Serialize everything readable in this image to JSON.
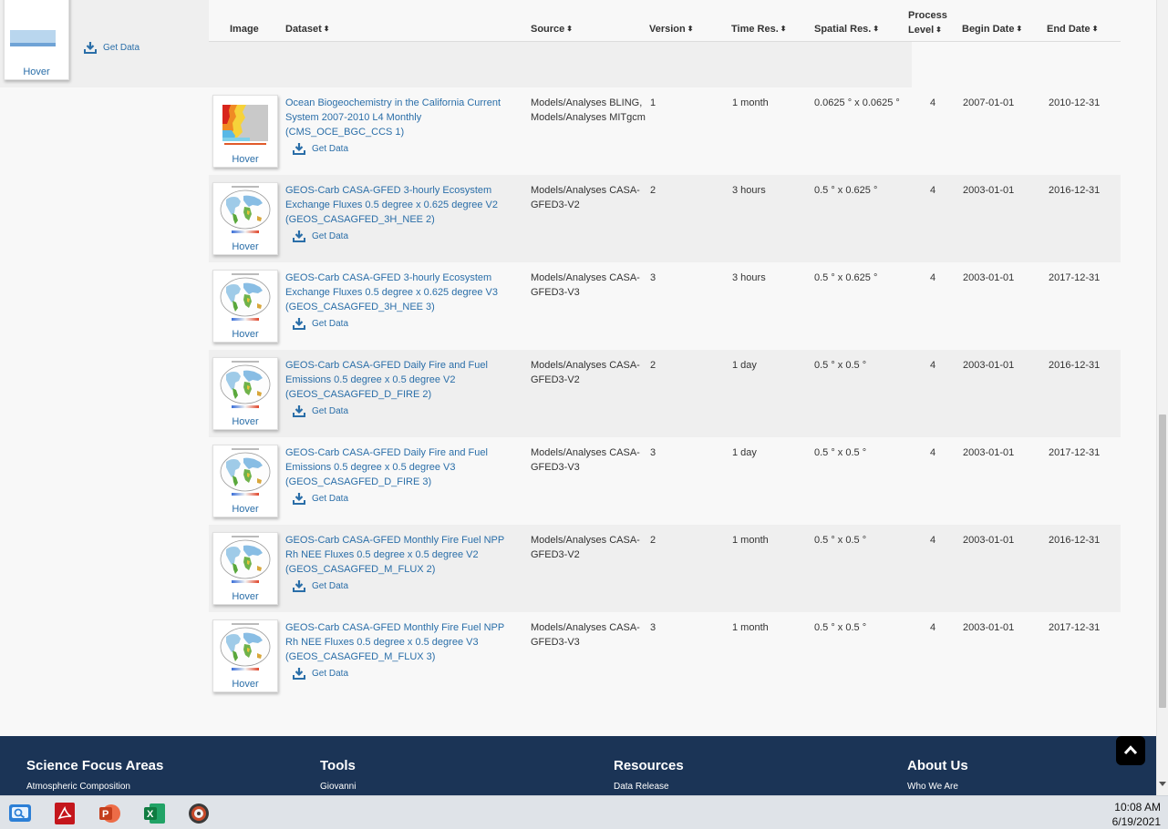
{
  "table": {
    "headers": {
      "image": "Image",
      "dataset": "Dataset",
      "source": "Source",
      "version": "Version",
      "time_res": "Time Res.",
      "spatial_res": "Spatial Res.",
      "process_level_1": "Process",
      "process_level_2": "Level",
      "begin_date": "Begin Date",
      "end_date": "End Date"
    },
    "sort_glyph": "⬍",
    "hover_label": "Hover",
    "get_data_label": "Get Data",
    "rows": [
      {
        "dataset": "Ocean Biogeochemistry in the California Current System 2007-2010 L4 Monthly (CMS_OCE_BGC_CCS 1)",
        "source": "Models/Analyses BLING, Models/Analyses MITgcm",
        "version": "1",
        "time_res": "1 month",
        "spatial_res": "0.0625 ° x 0.0625 °",
        "process_level": "4",
        "begin_date": "2007-01-01",
        "end_date": "2010-12-31",
        "thumb_type": "ocean-heatmap"
      },
      {
        "dataset": "GEOS-Carb CASA-GFED 3-hourly Ecosystem Exchange Fluxes 0.5 degree x 0.625 degree V2 (GEOS_CASAGFED_3H_NEE 2)",
        "source": "Models/Analyses CASA-GFED3-V2",
        "version": "2",
        "time_res": "3 hours",
        "spatial_res": "0.5 ° x 0.625 °",
        "process_level": "4",
        "begin_date": "2003-01-01",
        "end_date": "2016-12-31",
        "thumb_type": "globe-map"
      },
      {
        "dataset": "GEOS-Carb CASA-GFED 3-hourly Ecosystem Exchange Fluxes 0.5 degree x 0.625 degree V3 (GEOS_CASAGFED_3H_NEE 3)",
        "source": "Models/Analyses CASA-GFED3-V3",
        "version": "3",
        "time_res": "3 hours",
        "spatial_res": "0.5 ° x 0.625 °",
        "process_level": "4",
        "begin_date": "2003-01-01",
        "end_date": "2017-12-31",
        "thumb_type": "globe-map"
      },
      {
        "dataset": "GEOS-Carb CASA-GFED Daily Fire and Fuel Emissions 0.5 degree x 0.5 degree V2 (GEOS_CASAGFED_D_FIRE 2)",
        "source": "Models/Analyses CASA-GFED3-V2",
        "version": "2",
        "time_res": "1 day",
        "spatial_res": "0.5 ° x 0.5 °",
        "process_level": "4",
        "begin_date": "2003-01-01",
        "end_date": "2016-12-31",
        "thumb_type": "globe-map"
      },
      {
        "dataset": "GEOS-Carb CASA-GFED Daily Fire and Fuel Emissions 0.5 degree x 0.5 degree V3 (GEOS_CASAGFED_D_FIRE 3)",
        "source": "Models/Analyses CASA-GFED3-V3",
        "version": "3",
        "time_res": "1 day",
        "spatial_res": "0.5 ° x 0.5 °",
        "process_level": "4",
        "begin_date": "2003-01-01",
        "end_date": "2017-12-31",
        "thumb_type": "globe-map"
      },
      {
        "dataset": "GEOS-Carb CASA-GFED Monthly Fire Fuel NPP Rh NEE Fluxes 0.5 degree x 0.5 degree V2 (GEOS_CASAGFED_M_FLUX 2)",
        "source": "Models/Analyses CASA-GFED3-V2",
        "version": "2",
        "time_res": "1 month",
        "spatial_res": "0.5 ° x 0.5 °",
        "process_level": "4",
        "begin_date": "2003-01-01",
        "end_date": "2016-12-31",
        "thumb_type": "globe-map"
      },
      {
        "dataset": "GEOS-Carb CASA-GFED Monthly Fire Fuel NPP Rh NEE Fluxes 0.5 degree x 0.5 degree V3 (GEOS_CASAGFED_M_FLUX 3)",
        "source": "Models/Analyses CASA-GFED3-V3",
        "version": "3",
        "time_res": "1 month",
        "spatial_res": "0.5 ° x 0.5 °",
        "process_level": "4",
        "begin_date": "2003-01-01",
        "end_date": "2017-12-31",
        "thumb_type": "globe-map"
      }
    ]
  },
  "footer": {
    "columns": [
      {
        "heading": "Science Focus Areas",
        "first_link": "Atmospheric Composition"
      },
      {
        "heading": "Tools",
        "first_link": "Giovanni"
      },
      {
        "heading": "Resources",
        "first_link": "Data Release"
      },
      {
        "heading": "About Us",
        "first_link": "Who We Are"
      }
    ]
  },
  "taskbar": {
    "apps": [
      "windows-search-icon",
      "adobe-acrobat-icon",
      "powerpoint-icon",
      "excel-icon",
      "media-player-icon"
    ],
    "time": "10:08 AM",
    "date": "6/19/2021"
  },
  "colors": {
    "link": "#2a6ea8",
    "footer_bg": "#1b3456",
    "row_alt": "#efefef",
    "row_base": "#f8f8f8"
  }
}
